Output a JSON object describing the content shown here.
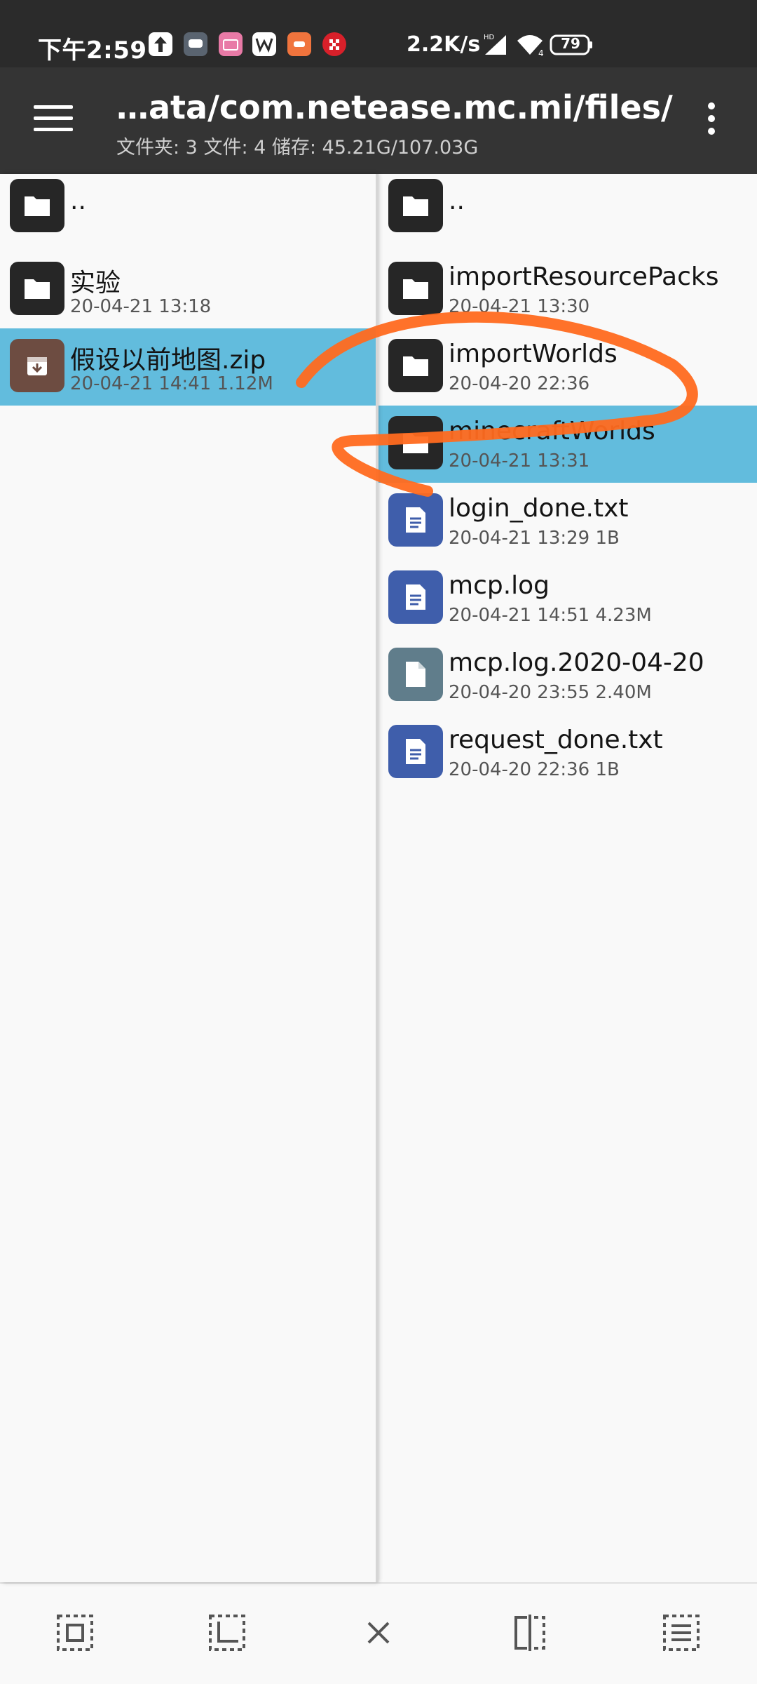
{
  "status_bar": {
    "time": "下午2:59",
    "net_speed": "2.2K/s",
    "battery": "79",
    "notification_icons": [
      "upload-icon",
      "chat-app-icon",
      "shop-app-icon",
      "wps-icon",
      "game-app-icon",
      "pattern-app-icon"
    ]
  },
  "toolbar": {
    "path": "…ata/com.netease.mc.mi/files/",
    "info": "文件夹: 3  文件: 4  储存: 45.21G/107.03G"
  },
  "left_pane": {
    "items": [
      {
        "name": "..",
        "meta": "",
        "type": "folder",
        "selected": false
      },
      {
        "name": "实验",
        "meta": "20-04-21 13:18",
        "type": "folder",
        "selected": false
      },
      {
        "name": "假设以前地图.zip",
        "meta": "20-04-21 14:41  1.12M",
        "type": "zip",
        "selected": true
      }
    ]
  },
  "right_pane": {
    "items": [
      {
        "name": "..",
        "meta": "",
        "type": "folder",
        "selected": false
      },
      {
        "name": "importResourcePacks",
        "meta": "20-04-21 13:30",
        "type": "folder",
        "selected": false
      },
      {
        "name": "importWorlds",
        "meta": "20-04-20 22:36",
        "type": "folder",
        "selected": false
      },
      {
        "name": "minecraftWorlds",
        "meta": "20-04-21 13:31",
        "type": "folder",
        "selected": true
      },
      {
        "name": "login_done.txt",
        "meta": "20-04-21 13:29  1B",
        "type": "doc",
        "selected": false
      },
      {
        "name": "mcp.log",
        "meta": "20-04-21 14:51  4.23M",
        "type": "doc",
        "selected": false
      },
      {
        "name": "mcp.log.2020-04-20",
        "meta": "20-04-20 23:55  2.40M",
        "type": "file",
        "selected": false
      },
      {
        "name": "request_done.txt",
        "meta": "20-04-20 22:36  1B",
        "type": "doc",
        "selected": false
      }
    ]
  },
  "bottom_bar": {
    "buttons": [
      "select-all-icon",
      "select-range-icon",
      "close-icon",
      "split-view-icon",
      "list-view-icon"
    ]
  },
  "colors": {
    "status_bg": "#2b2b2b",
    "toolbar_bg": "#343434",
    "selection": "#62bcdd",
    "annotation": "#ff6a1f"
  }
}
